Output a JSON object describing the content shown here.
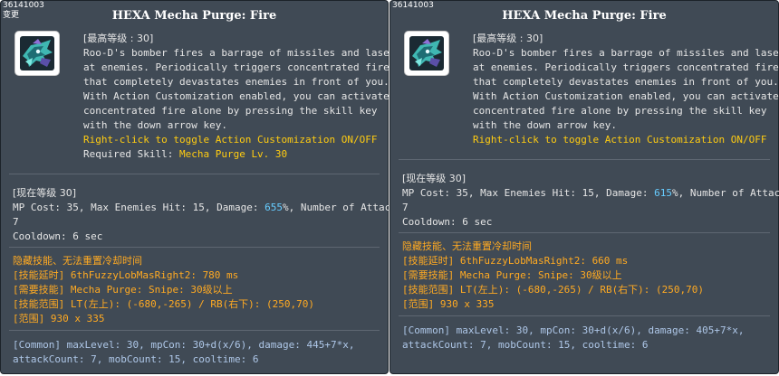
{
  "panels": [
    {
      "skill_id": "36141003",
      "changed_label": "变更",
      "title": "HEXA Mecha Purge: Fire",
      "max_level": "[最高等级 : 30]",
      "description": [
        "Roo-D's bomber fires a barrage of missiles and lasers",
        "at enemies. Periodically triggers concentrated fire",
        "that completely devastates enemies in front of you.",
        "With Action Customization enabled, you can activate",
        "concentrated fire alone by pressing the skill key",
        "with the down arrow key."
      ],
      "toggle_hint": "Right-click to toggle Action Customization ON/OFF",
      "required_skill_label": "Required Skill: ",
      "required_skill_value": "Mecha Purge Lv. 30",
      "current_level": "[现在等级 30]",
      "stats_prefix": "MP Cost: 35, Max Enemies Hit: 15, Damage: ",
      "damage_value": "655",
      "stats_suffix": "%, Number of Attacks:",
      "attacks_value": "7",
      "cooldown": "Cooldown: 6 sec",
      "hidden_note": "隐藏技能、无法重置冷却时间",
      "tech": [
        "[技能延时] 6thFuzzyLobMasRight2: 780 ms",
        "[需要技能] Mecha Purge: Snipe: 30级以上",
        "[技能范围] LT(左上): (-680,-265) / RB(右下): (250,70)",
        "[范围] 930 x 335"
      ],
      "common": [
        "[Common] maxLevel: 30, mpCon: 30+d(x/6), damage: 445+7*x,",
        "attackCount: 7, mobCount: 15, cooltime: 6"
      ]
    },
    {
      "skill_id": "36141003",
      "title": "HEXA Mecha Purge: Fire",
      "max_level": "[最高等级 : 30]",
      "description": [
        "Roo-D's bomber fires a barrage of missiles and lasers",
        "at enemies. Periodically triggers concentrated fire",
        "that completely devastates enemies in front of you.",
        "With Action Customization enabled, you can activate",
        "concentrated fire alone by pressing the skill key",
        "with the down arrow key."
      ],
      "toggle_hint": "Right-click to toggle Action Customization ON/OFF",
      "current_level": "[现在等级 30]",
      "stats_prefix": "MP Cost: 35, Max Enemies Hit: 15, Damage: ",
      "damage_value": "615",
      "stats_suffix": "%, Number of Attacks:",
      "attacks_value": "7",
      "cooldown": "Cooldown: 6 sec",
      "hidden_note": "隐藏技能、无法重置冷却时间",
      "tech": [
        "[技能延时] 6thFuzzyLobMasRight2: 660 ms",
        "[需要技能] Mecha Purge: Snipe: 30级以上",
        "[技能范围] LT(左上): (-680,-265) / RB(右下): (250,70)",
        "[范围] 930 x 335"
      ],
      "common": [
        "[Common] maxLevel: 30, mpCon: 30+d(x/6), damage: 405+7*x,",
        "attackCount: 7, mobCount: 15, cooltime: 6"
      ]
    }
  ],
  "icons": {
    "skill": "mecha-purge-fire-skill-icon"
  },
  "colors": {
    "panel_bg": "#404a55",
    "highlight_orange": "#ffaa22",
    "highlight_yellow": "#ffcc11",
    "damage_cyan": "#66ccff",
    "common_info": "#aec7e8"
  }
}
